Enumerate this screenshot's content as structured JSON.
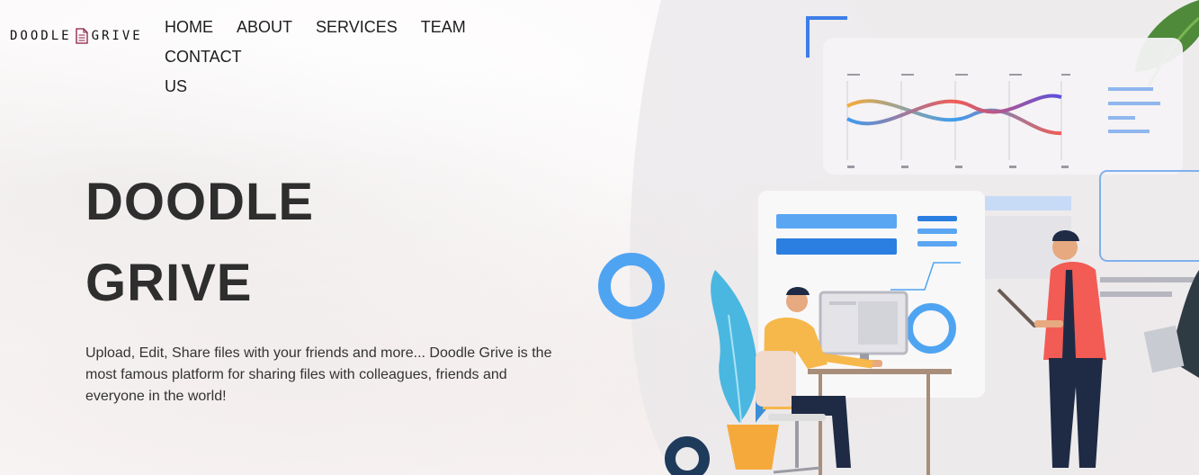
{
  "brand": {
    "logo_left": "DOODLE",
    "logo_right": "GRIVE"
  },
  "nav": {
    "items": [
      "HOME",
      "ABOUT",
      "SERVICES",
      "TEAM",
      "CONTACT US"
    ]
  },
  "hero": {
    "title_line1": "DOODLE",
    "title_line2": "GRIVE",
    "description": "Upload, Edit, Share files with your friends and more... Doodle Grive is the most famous platform for sharing files with colleagues, friends and everyone in the world!"
  },
  "colors": {
    "accent_blue": "#3d9cf0",
    "navy": "#1f3b5b",
    "coral": "#f25c54",
    "orange": "#f6a93b"
  }
}
